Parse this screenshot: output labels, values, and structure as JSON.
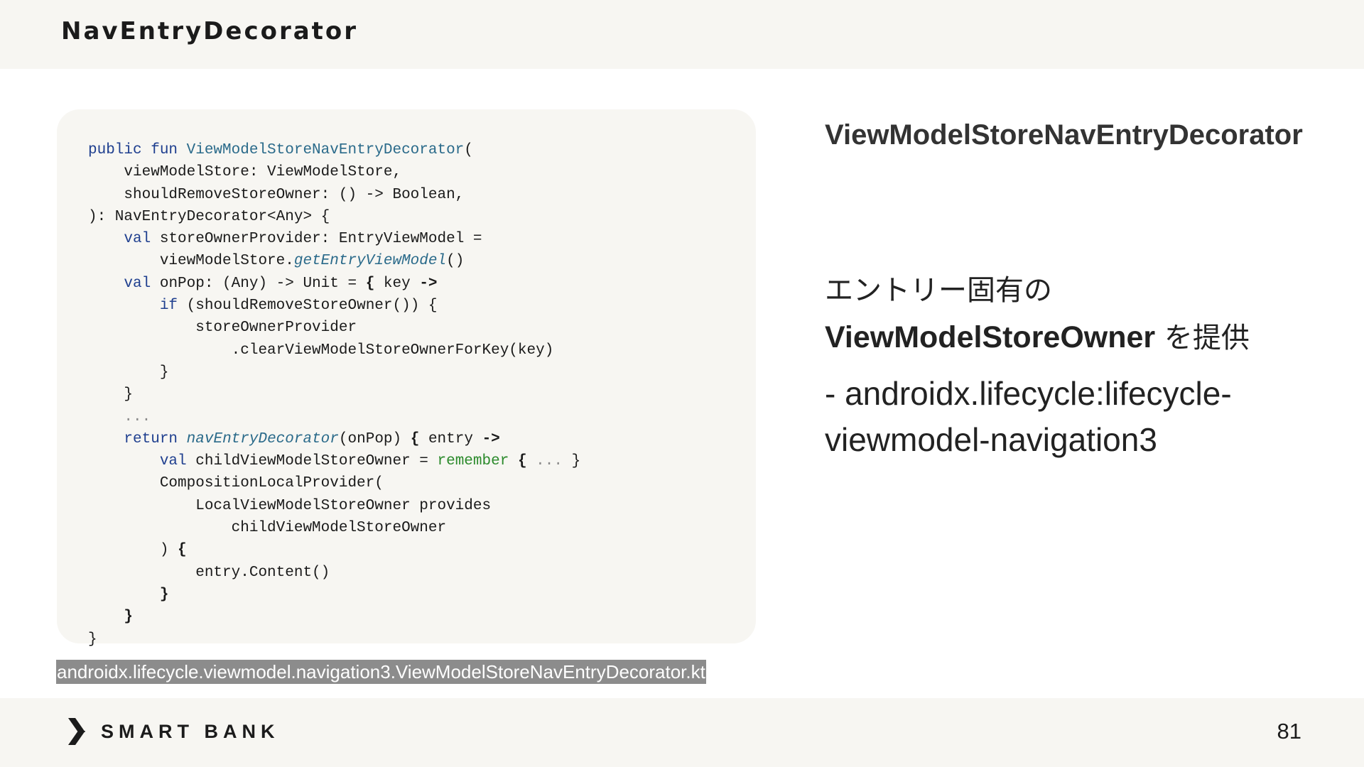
{
  "header": {
    "title": "NavEntryDecorator"
  },
  "code": {
    "l1_kw": "public fun ",
    "l1_fn": "ViewModelStoreNavEntryDecorator",
    "l1_rest": "(",
    "l2": "    viewModelStore: ViewModelStore,",
    "l3": "    shouldRemoveStoreOwner: () -> Boolean,",
    "l4": "): NavEntryDecorator<Any> {",
    "l5_ind": "    ",
    "l5_kw": "val",
    "l5_rest": " storeOwnerProvider: EntryViewModel =",
    "l6_pre": "        viewModelStore.",
    "l6_it": "getEntryViewModel",
    "l6_rest": "()",
    "l7_ind": "    ",
    "l7_kw": "val",
    "l7_rest": " onPop: (Any) -> Unit = ",
    "l7_b1": "{",
    "l7_mid": " key ",
    "l7_b2": "->",
    "l8_ind": "        ",
    "l8_kw": "if",
    "l8_rest": " (shouldRemoveStoreOwner()) {",
    "l9": "            storeOwnerProvider",
    "l10": "                .clearViewModelStoreOwnerForKey(key)",
    "l11": "        }",
    "l12": "    }",
    "l13": "    ...",
    "l14_ind": "    ",
    "l14_kw": "return",
    "l14_sp": " ",
    "l14_it": "navEntryDecorator",
    "l14_rest": "(onPop) ",
    "l14_b": "{",
    "l14_mid": " entry ",
    "l14_b2": "->",
    "l15_ind": "        ",
    "l15_kw": "val",
    "l15_rest": " childViewModelStoreOwner = ",
    "l15_gr": "remember",
    "l15_sp": " ",
    "l15_b": "{",
    "l15_cm": " ... ",
    "l15_end": "}",
    "l16": "        CompositionLocalProvider(",
    "l17": "            LocalViewModelStoreOwner provides",
    "l18": "                childViewModelStoreOwner",
    "l19_pre": "        ) ",
    "l19_b": "{",
    "l20": "            entry.Content()",
    "l21_ind": "        ",
    "l21_b": "}",
    "l22_ind": "    ",
    "l22_b": "}",
    "l23": "}"
  },
  "source_label": "androidx.lifecycle.viewmodel.navigation3.ViewModelStoreNavEntryDecorator.kt",
  "right": {
    "title": "ViewModelStoreNavEntryDecorator",
    "desc_jp1": "エントリー固有の",
    "desc_strong": "ViewModelStoreOwner",
    "desc_jp2": " を提供",
    "sub": "  - androidx.lifecycle:lifecycle-viewmodel-navigation3"
  },
  "footer": {
    "logo_text": "SMART BANK",
    "logo_icon": "smartbank-logo-icon",
    "page_number": "81"
  }
}
